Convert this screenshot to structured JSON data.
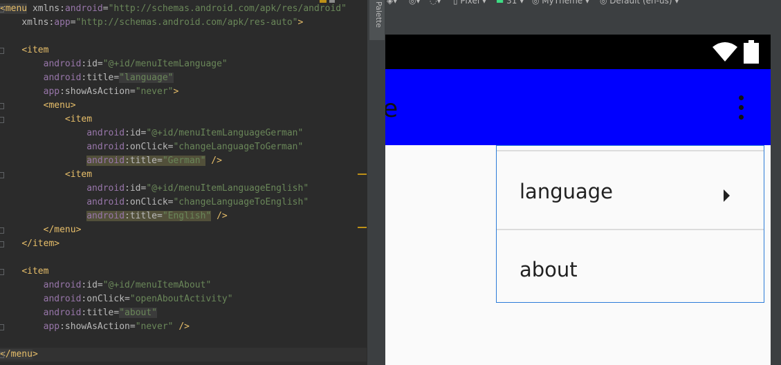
{
  "editor": {
    "lines": [
      [
        {
          "t": "<menu",
          "c": "tag",
          "box": "hl-box"
        },
        {
          "t": " "
        },
        {
          "t": "xmlns:",
          "c": "attr"
        },
        {
          "t": "android",
          "c": "attr-ns"
        },
        {
          "t": "=",
          "c": "attr"
        },
        {
          "t": "\"http://schemas.android.com/apk/res/android\"",
          "c": "val"
        }
      ],
      [
        {
          "t": "    "
        },
        {
          "t": "xmlns:",
          "c": "attr"
        },
        {
          "t": "app",
          "c": "attr-ns"
        },
        {
          "t": "=",
          "c": "attr"
        },
        {
          "t": "\"http://schemas.android.com/apk/res-auto\"",
          "c": "val"
        },
        {
          "t": ">",
          "c": "tag"
        }
      ],
      [],
      [
        {
          "t": "    "
        },
        {
          "t": "<item",
          "c": "tag"
        }
      ],
      [
        {
          "t": "        "
        },
        {
          "t": "android",
          "c": "attr-ns"
        },
        {
          "t": ":id=",
          "c": "attr"
        },
        {
          "t": "\"@+id/menuItemLanguage\"",
          "c": "val"
        }
      ],
      [
        {
          "t": "        "
        },
        {
          "t": "android",
          "c": "attr-ns"
        },
        {
          "t": ":title=",
          "c": "attr"
        },
        {
          "t": "\"language\"",
          "c": "val",
          "box": "hl-box"
        }
      ],
      [
        {
          "t": "        "
        },
        {
          "t": "app",
          "c": "attr-ns"
        },
        {
          "t": ":showAsAction=",
          "c": "attr"
        },
        {
          "t": "\"never\"",
          "c": "val"
        },
        {
          "t": ">",
          "c": "tag"
        }
      ],
      [
        {
          "t": "        "
        },
        {
          "t": "<menu>",
          "c": "tag"
        }
      ],
      [
        {
          "t": "            "
        },
        {
          "t": "<item",
          "c": "tag"
        }
      ],
      [
        {
          "t": "                "
        },
        {
          "t": "android",
          "c": "attr-ns"
        },
        {
          "t": ":id=",
          "c": "attr"
        },
        {
          "t": "\"@+id/menuItemLanguageGerman\"",
          "c": "val"
        }
      ],
      [
        {
          "t": "                "
        },
        {
          "t": "android",
          "c": "attr-ns"
        },
        {
          "t": ":onClick=",
          "c": "attr"
        },
        {
          "t": "\"changeLanguageToGerman\"",
          "c": "val"
        }
      ],
      [
        {
          "t": "                "
        },
        {
          "t": "android",
          "c": "attr-ns",
          "box": "hl-warn"
        },
        {
          "t": ":title=",
          "c": "attr",
          "box": "hl-warn"
        },
        {
          "t": "\"German\"",
          "c": "val",
          "box": "hl-warn"
        },
        {
          "t": " "
        },
        {
          "t": "/>",
          "c": "tag"
        }
      ],
      [
        {
          "t": "            "
        },
        {
          "t": "<item",
          "c": "tag"
        }
      ],
      [
        {
          "t": "                "
        },
        {
          "t": "android",
          "c": "attr-ns"
        },
        {
          "t": ":id=",
          "c": "attr"
        },
        {
          "t": "\"@+id/menuItemLanguageEnglish\"",
          "c": "val"
        }
      ],
      [
        {
          "t": "                "
        },
        {
          "t": "android",
          "c": "attr-ns"
        },
        {
          "t": ":onClick=",
          "c": "attr"
        },
        {
          "t": "\"changeLanguageToEnglish\"",
          "c": "val"
        }
      ],
      [
        {
          "t": "                "
        },
        {
          "t": "android",
          "c": "attr-ns",
          "box": "hl-warn"
        },
        {
          "t": ":title=",
          "c": "attr",
          "box": "hl-warn"
        },
        {
          "t": "\"English\"",
          "c": "val",
          "box": "hl-warn"
        },
        {
          "t": " "
        },
        {
          "t": "/>",
          "c": "tag"
        }
      ],
      [
        {
          "t": "        "
        },
        {
          "t": "</menu>",
          "c": "tag"
        }
      ],
      [
        {
          "t": "    "
        },
        {
          "t": "</item>",
          "c": "tag"
        }
      ],
      [],
      [
        {
          "t": "    "
        },
        {
          "t": "<item",
          "c": "tag"
        }
      ],
      [
        {
          "t": "        "
        },
        {
          "t": "android",
          "c": "attr-ns"
        },
        {
          "t": ":id=",
          "c": "attr"
        },
        {
          "t": "\"@+id/menuItemAbout\"",
          "c": "val"
        }
      ],
      [
        {
          "t": "        "
        },
        {
          "t": "android",
          "c": "attr-ns"
        },
        {
          "t": ":onClick=",
          "c": "attr"
        },
        {
          "t": "\"openAboutActivity\"",
          "c": "val"
        }
      ],
      [
        {
          "t": "        "
        },
        {
          "t": "android",
          "c": "attr-ns"
        },
        {
          "t": ":title=",
          "c": "attr"
        },
        {
          "t": "\"about\"",
          "c": "val",
          "box": "hl-box"
        }
      ],
      [
        {
          "t": "        "
        },
        {
          "t": "app",
          "c": "attr-ns"
        },
        {
          "t": ":showAsAction=",
          "c": "attr"
        },
        {
          "t": "\"never\"",
          "c": "val"
        },
        {
          "t": " "
        },
        {
          "t": "/>",
          "c": "tag"
        }
      ],
      [],
      [
        {
          "t": "</menu",
          "c": "tag",
          "box": "hl-box"
        },
        {
          "t": ">",
          "c": "tag"
        }
      ]
    ]
  },
  "palette": {
    "label": "Palette"
  },
  "toolbar": {
    "device": "Pixel",
    "api": "31",
    "theme": "MyTheme",
    "locale": "Default (en-us)"
  },
  "preview": {
    "app_title": "are",
    "menu_items": [
      {
        "label": "language",
        "has_submenu": true
      },
      {
        "label": "about",
        "has_submenu": false
      }
    ],
    "colors": {
      "app_bar": "#0000ff",
      "status_bar": "#000000",
      "selection_border": "#2a7bd8"
    }
  }
}
